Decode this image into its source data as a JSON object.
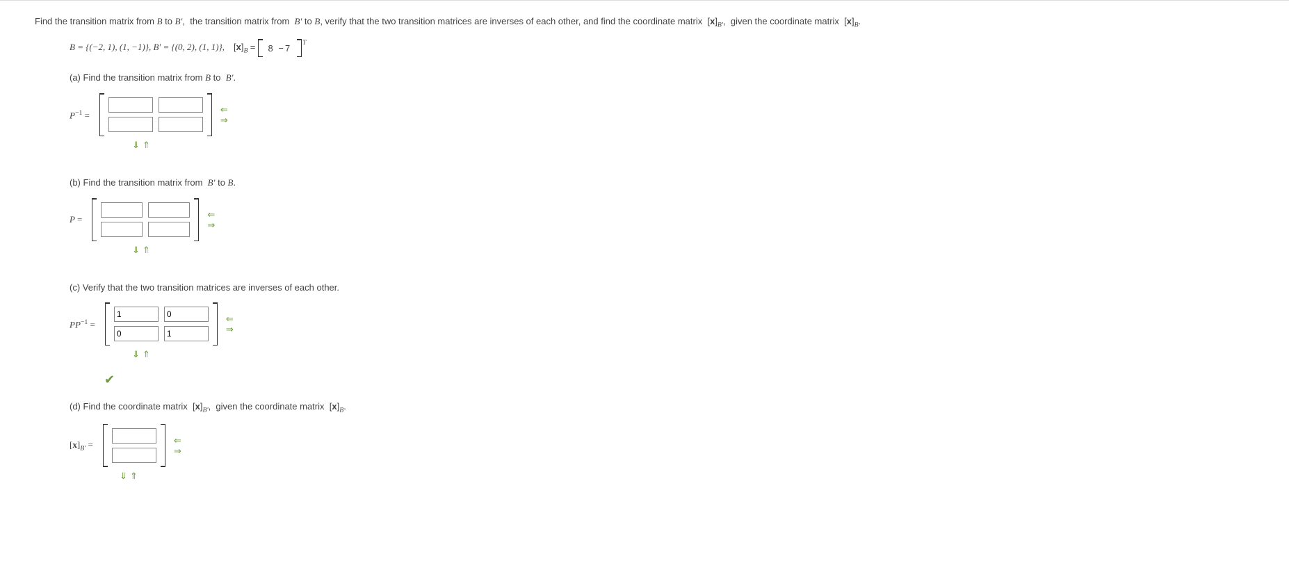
{
  "intro": "Find the transition matrix from B to  B′,  the transition matrix from  B′ to B, verify that the two transition matrices are inverses of each other, and find the coordinate matrix  [x]B′,  given the coordinate matrix  [x]B.",
  "given": {
    "B_eq": "B = {(−2, 1), (1, −1)}, B′ = {(0, 2), (1, 1)},",
    "xB_label": "[x]B =",
    "xB_vals": "8  −7",
    "T": "T"
  },
  "parts": {
    "a": {
      "label": "(a) Find the transition matrix from B to  B′.",
      "lhs": "P⁻¹ =",
      "rows": 2,
      "cols": 2,
      "values": [
        [
          "",
          ""
        ],
        [
          "",
          ""
        ]
      ]
    },
    "b": {
      "label": "(b) Find the transition matrix from  B′ to B.",
      "lhs": "P =",
      "rows": 2,
      "cols": 2,
      "values": [
        [
          "",
          ""
        ],
        [
          "",
          ""
        ]
      ]
    },
    "c": {
      "label": "(c) Verify that the two transition matrices are inverses of each other.",
      "lhs": "PP⁻¹ =",
      "rows": 2,
      "cols": 2,
      "values": [
        [
          "1",
          "0"
        ],
        [
          "0",
          "1"
        ]
      ],
      "correct": true
    },
    "d": {
      "label": "(d) Find the coordinate matrix  [x]B′,  given the coordinate matrix  [x]B.",
      "lhs": "[x]B′ =",
      "rows": 2,
      "cols": 1,
      "values": [
        [
          ""
        ],
        [
          ""
        ]
      ]
    }
  },
  "icons": {
    "left": "⇐",
    "right": "⇒",
    "down": "⇓",
    "up": "⇑",
    "check": "✔"
  }
}
